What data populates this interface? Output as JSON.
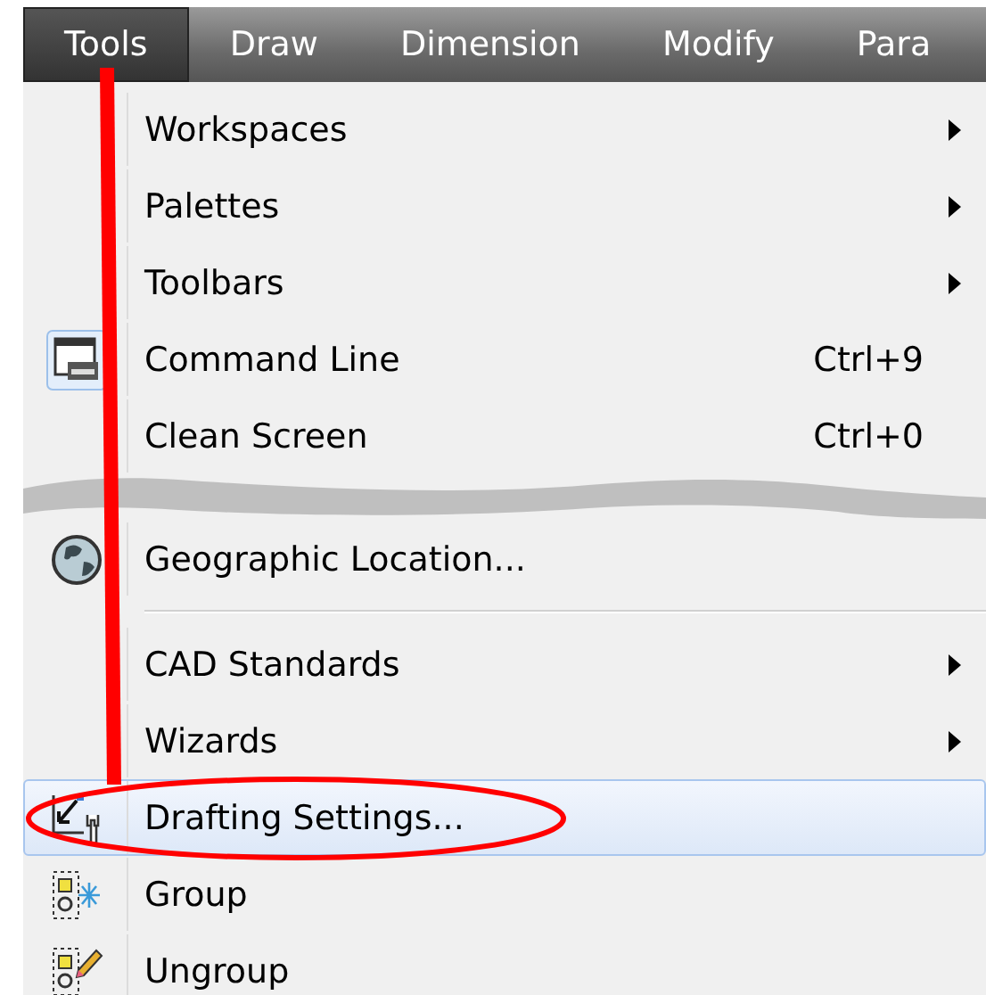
{
  "menubar": [
    {
      "label": "Tools",
      "selected": true
    },
    {
      "label": "Draw",
      "selected": false
    },
    {
      "label": "Dimension",
      "selected": false
    },
    {
      "label": "Modify",
      "selected": false
    },
    {
      "label": "Para",
      "selected": false
    }
  ],
  "menu": [
    {
      "kind": "submenu",
      "label": "Workspaces",
      "highlighted": false
    },
    {
      "kind": "submenu",
      "label": "Palettes",
      "highlighted": false
    },
    {
      "kind": "submenu",
      "label": "Toolbars",
      "highlighted": false
    },
    {
      "kind": "command",
      "label": "Command Line",
      "shortcut": "Ctrl+9",
      "highlighted": false
    },
    {
      "kind": "command",
      "label": "Clean Screen",
      "shortcut": "Ctrl+0",
      "highlighted": false
    },
    {
      "kind": "break"
    },
    {
      "kind": "command",
      "label": "Geographic Location...",
      "highlighted": false
    },
    {
      "kind": "separator"
    },
    {
      "kind": "submenu",
      "label": "CAD Standards",
      "highlighted": false
    },
    {
      "kind": "submenu",
      "label": "Wizards",
      "highlighted": false
    },
    {
      "kind": "command",
      "label": "Drafting Settings...",
      "highlighted": true
    },
    {
      "kind": "command",
      "label": "Group",
      "highlighted": false
    },
    {
      "kind": "command",
      "label": "Ungroup",
      "highlighted": false
    }
  ]
}
